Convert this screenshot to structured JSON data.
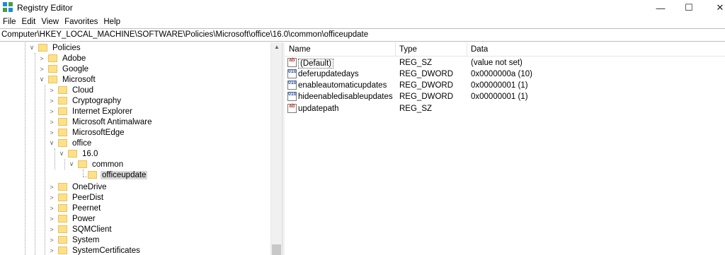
{
  "window": {
    "title": "Registry Editor",
    "minimize": "—",
    "maximize": "☐",
    "close": "✕"
  },
  "menu": [
    "File",
    "Edit",
    "View",
    "Favorites",
    "Help"
  ],
  "address": "Computer\\HKEY_LOCAL_MACHINE\\SOFTWARE\\Policies\\Microsoft\\office\\16.0\\common\\officeupdate",
  "tree": [
    {
      "label": "Policies",
      "expander": "∨"
    },
    {
      "label": "Adobe",
      "expander": ">"
    },
    {
      "label": "Google",
      "expander": ">"
    },
    {
      "label": "Microsoft",
      "expander": "∨"
    },
    {
      "label": "Cloud",
      "expander": ">"
    },
    {
      "label": "Cryptography",
      "expander": ">"
    },
    {
      "label": "Internet Explorer",
      "expander": ">"
    },
    {
      "label": "Microsoft Antimalware",
      "expander": ">"
    },
    {
      "label": "MicrosoftEdge",
      "expander": ">"
    },
    {
      "label": "office",
      "expander": "∨"
    },
    {
      "label": "16.0",
      "expander": "∨"
    },
    {
      "label": "common",
      "expander": "∨"
    },
    {
      "label": "officeupdate",
      "expander": ""
    },
    {
      "label": "OneDrive",
      "expander": ">"
    },
    {
      "label": "PeerDist",
      "expander": ">"
    },
    {
      "label": "Peernet",
      "expander": ">"
    },
    {
      "label": "Power",
      "expander": ">"
    },
    {
      "label": "SQMClient",
      "expander": ">"
    },
    {
      "label": "System",
      "expander": ">"
    },
    {
      "label": "SystemCertificates",
      "expander": ">"
    }
  ],
  "columns": {
    "name": "Name",
    "type": "Type",
    "data": "Data"
  },
  "values": [
    {
      "icon": "ab",
      "name": "(Default)",
      "type": "REG_SZ",
      "data": "(value not set)"
    },
    {
      "icon": "010",
      "name": "deferupdatedays",
      "type": "REG_DWORD",
      "data": "0x0000000a (10)"
    },
    {
      "icon": "010",
      "name": "enableautomaticupdates",
      "type": "REG_DWORD",
      "data": "0x00000001 (1)"
    },
    {
      "icon": "010",
      "name": "hideenabledisableupdates",
      "type": "REG_DWORD",
      "data": "0x00000001 (1)"
    },
    {
      "icon": "ab",
      "name": "updatepath",
      "type": "REG_SZ",
      "data": ""
    }
  ],
  "colors": {
    "highlight": "#fff200",
    "folder": "#ffe08a",
    "selected_key": "#d9d9d9"
  }
}
